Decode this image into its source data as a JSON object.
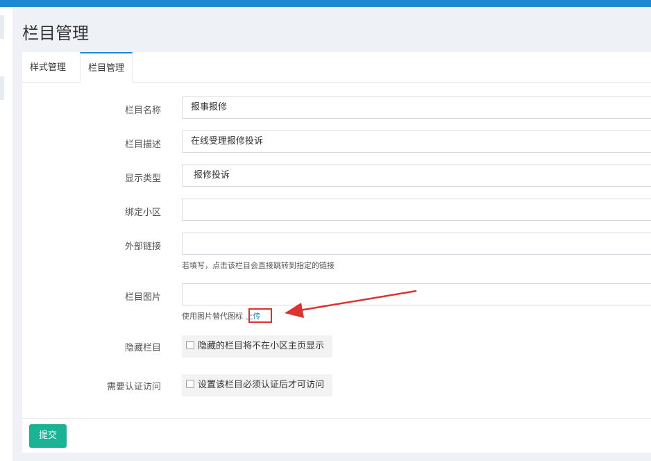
{
  "page_title": "栏目管理",
  "tabs": [
    {
      "label": "样式管理"
    },
    {
      "label": "栏目管理"
    }
  ],
  "form": {
    "fields": [
      {
        "label": "栏目名称",
        "value": "报事报修"
      },
      {
        "label": "栏目描述",
        "value": "在线受理报修投诉"
      },
      {
        "label": "显示类型",
        "value": "报修投诉"
      },
      {
        "label": "绑定小区",
        "value": ""
      },
      {
        "label": "外部链接",
        "value": "",
        "help": "若填写，点击该栏目会直接跳转到指定的链接"
      },
      {
        "label": "栏目图片",
        "value": "",
        "help": "使用图片替代图标",
        "link": "上传"
      }
    ],
    "checkboxes": [
      {
        "label": "隐藏栏目",
        "text": "隐藏的栏目将不在小区主页显示",
        "checked": false
      },
      {
        "label": "需要认证访问",
        "text": "设置该栏目必须认证后才可访问",
        "checked": false
      }
    ]
  },
  "submit_label": "提交",
  "colors": {
    "accent": "#1e88d0",
    "submit": "#1ab394",
    "annotation": "#e03131"
  }
}
